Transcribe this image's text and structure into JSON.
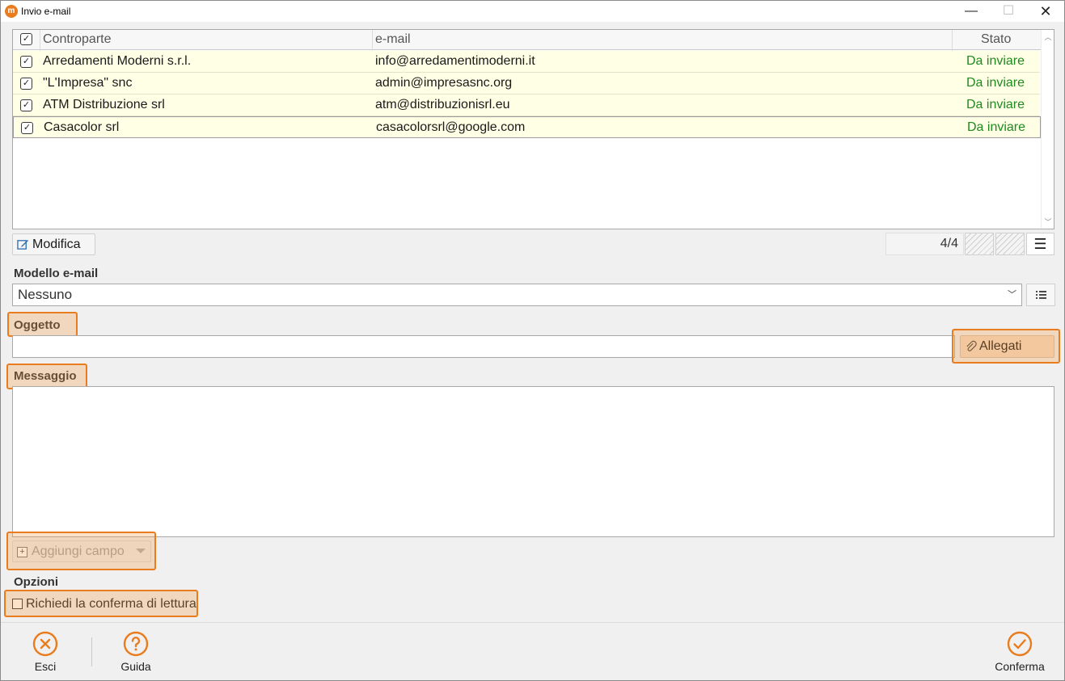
{
  "window": {
    "title": "Invio e-mail",
    "app_icon_letter": "m",
    "controls": {
      "minimize": "—",
      "maximize": "☐",
      "close": "✕"
    }
  },
  "grid": {
    "columns": [
      "Controparte",
      "e-mail",
      "Stato"
    ],
    "rows": [
      {
        "name": "Arredamenti Moderni s.r.l.",
        "email": "info@arredamentimoderni.it",
        "status": "Da inviare",
        "checked": true
      },
      {
        "name": "\"L'Impresa\" snc",
        "email": "admin@impresasnc.org",
        "status": "Da inviare",
        "checked": true
      },
      {
        "name": "ATM Distribuzione srl",
        "email": "atm@distribuzionisrl.eu",
        "status": "Da inviare",
        "checked": true
      },
      {
        "name": "Casacolor srl",
        "email": "casacolorsrl@google.com",
        "status": "Da inviare",
        "checked": true
      }
    ],
    "counter": "4/4",
    "status_color": "#1e8a1e",
    "row_background": "#ffffe6"
  },
  "toolbar": {
    "edit_label": "Modifica",
    "edit_icon": "edit-icon",
    "menu_icon": "hamburger-icon"
  },
  "template": {
    "label": "Modello e-mail",
    "selected": "Nessuno",
    "list_icon": "list-icon"
  },
  "subject": {
    "label": "Oggetto",
    "value": ""
  },
  "attachments": {
    "label": "Allegati",
    "icon": "paperclip-icon"
  },
  "message": {
    "label": "Messaggio",
    "value": ""
  },
  "add_field": {
    "label": "Aggiungi campo",
    "enabled": false
  },
  "options": {
    "label": "Opzioni",
    "read_receipt_label": "Richiedi la conferma di lettura",
    "read_receipt_checked": false
  },
  "footer": {
    "exit_label": "Esci",
    "help_label": "Guida",
    "confirm_label": "Conferma",
    "accent_color": "#e87c1e"
  }
}
